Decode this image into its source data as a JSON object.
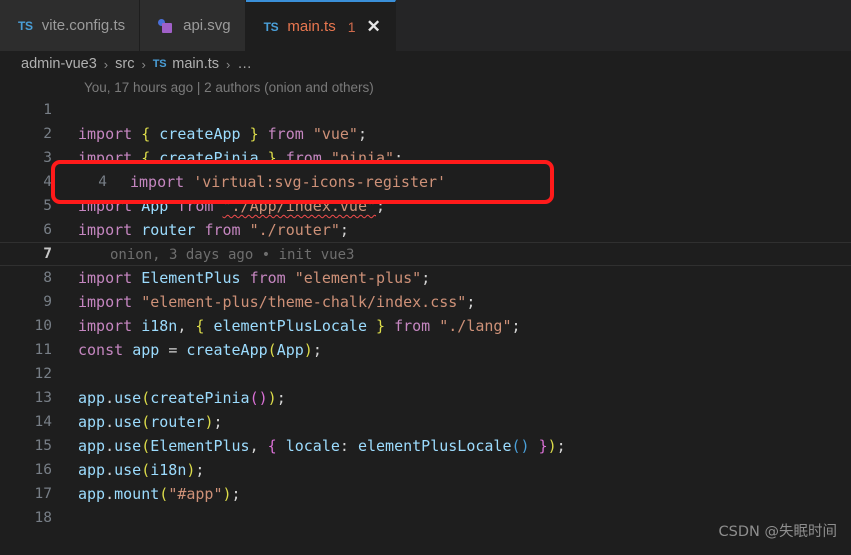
{
  "tabs": [
    {
      "icon": "ts-icon",
      "label": "vite.config.ts",
      "active": false
    },
    {
      "icon": "svg-icon",
      "label": "api.svg",
      "active": false
    },
    {
      "icon": "ts-icon",
      "label": "main.ts",
      "active": true,
      "badge": "1",
      "close": "✕"
    }
  ],
  "breadcrumb": {
    "crumb1": "admin-vue3",
    "sep1": "›",
    "crumb2": "src",
    "sep2": "›",
    "file_icon": "TS",
    "crumb3": "main.ts",
    "sep3": "›",
    "ellipsis": "…"
  },
  "blame_header": "You, 17 hours ago | 2 authors (onion and others)",
  "editor": {
    "lines": [
      {
        "n": "1",
        "text": ""
      },
      {
        "n": "2",
        "text": "import { createApp } from \"vue\";"
      },
      {
        "n": "3",
        "text": "import { createPinia } from \"pinia\";"
      },
      {
        "n": "4",
        "text": "import 'virtual:svg-icons-register'"
      },
      {
        "n": "5",
        "text": "import App from \"./App/index.vue\";"
      },
      {
        "n": "6",
        "text": "import router from \"./router\";"
      },
      {
        "n": "7",
        "text": "",
        "blame": "onion, 3 days ago • init vue3",
        "current": true
      },
      {
        "n": "8",
        "text": "import ElementPlus from \"element-plus\";"
      },
      {
        "n": "9",
        "text": "import \"element-plus/theme-chalk/index.css\";"
      },
      {
        "n": "10",
        "text": "import i18n, { elementPlusLocale } from \"./lang\";"
      },
      {
        "n": "11",
        "text": "const app = createApp(App);"
      },
      {
        "n": "12",
        "text": ""
      },
      {
        "n": "13",
        "text": "app.use(createPinia());"
      },
      {
        "n": "14",
        "text": "app.use(router);"
      },
      {
        "n": "15",
        "text": "app.use(ElementPlus, { locale: elementPlusLocale() });"
      },
      {
        "n": "16",
        "text": "app.use(i18n);"
      },
      {
        "n": "17",
        "text": "app.mount(\"#app\");"
      },
      {
        "n": "18",
        "text": ""
      }
    ]
  },
  "annotation": {
    "highlighted_line_number": "4",
    "highlighted_code": "import 'virtual:svg-icons-register'",
    "box_color": "#ff1a1a"
  },
  "watermark": "CSDN @失眠时间",
  "colors": {
    "editor_background": "#1e1e1e",
    "tabbar_background": "#252526",
    "inactive_tab_background": "#2d2d2d",
    "active_tab_border": "#3a8fd8",
    "keyword": "#c586c0",
    "string": "#ce9178",
    "variable": "#9cdcfe",
    "brace": "#dcdc4a",
    "error": "#f14c4c",
    "line_number": "#777e86"
  }
}
